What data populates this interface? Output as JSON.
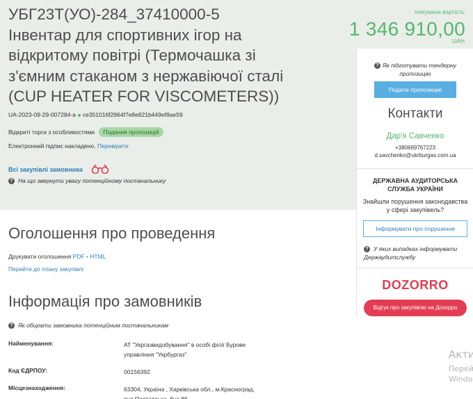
{
  "tender": {
    "title": "УБГ23Т(УО)-284_37410000-5 Інвентар для спортивних ігор на відкритому повітрі (Термочашка зі з'ємним стаканом з нержавіючої сталі (CUP HEATER FOR VISCOMETERS))",
    "id": "UA-2023-09-29-007284-a",
    "hash": "ce351016f2964f7e8e821b449ef8ae59",
    "procedure_type": "Відкриті торги з особливостями",
    "status": "Подання пропозицій",
    "signature_text": "Електронний підпис накладено.",
    "signature_link": "Перевірити",
    "all_purchases": "Всі закупівлі замовника",
    "attention_text": "На що звернути увагу потенційному постачальнику"
  },
  "price": {
    "label": "очікувана вартість",
    "value": "1 346 910,00",
    "currency": "UAH"
  },
  "announcement": {
    "title": "Оголошення про проведення",
    "print_label": "Друкувати оголошення",
    "pdf": "PDF",
    "html": "HTML",
    "plan_link": "Перейти до плану закупівлі"
  },
  "owners": {
    "title": "Інформація про замовників",
    "how_choose": "Як обирати замовника потенційним постачальникам",
    "rows": [
      {
        "label": "Найменування:",
        "value": "АТ \"Укргазвидобування\" в особі філії Бурове управління \"Укрбургаз\""
      },
      {
        "label": "Код ЄДРПОУ:",
        "value": "00156392"
      },
      {
        "label": "Місцезнаходження:",
        "value": "63304, Україна , Харківська обл., м.Красноград, вул.Полтавська, буд.86"
      }
    ]
  },
  "side": {
    "help_link": "Як підготувати тендерну пропозицію",
    "submit_label": "Подати пропозицію",
    "contacts_title": "Контакти",
    "contact_name": "Дар'я Савченко",
    "contact_phone": "+380669767223",
    "contact_email": "d.savchenko@ukrburgas.com.ua",
    "audit_title": "ДЕРЖАВНА АУДИТОРСЬКА СЛУЖБА УКРАЇНИ",
    "audit_text": "Знайшли порушення законодавства у сфері закупівель?",
    "report_label": "Інформувати про порушення",
    "when_report": "У яких випадках інформувати Держаудитслужбу",
    "dozorro_logo": "DOZORRO",
    "feedback_label": "Відгук про закупівлю на Дозорро"
  },
  "watermark": {
    "line1": "Акти",
    "line2": "Перей,",
    "line3": "Windo"
  },
  "colors": {
    "accent_green": "#56b56f",
    "link_blue": "#2f7fb8",
    "button_blue": "#5aaee0",
    "dozorro_red": "#e23d52",
    "header_bg": "#e9eee9"
  }
}
